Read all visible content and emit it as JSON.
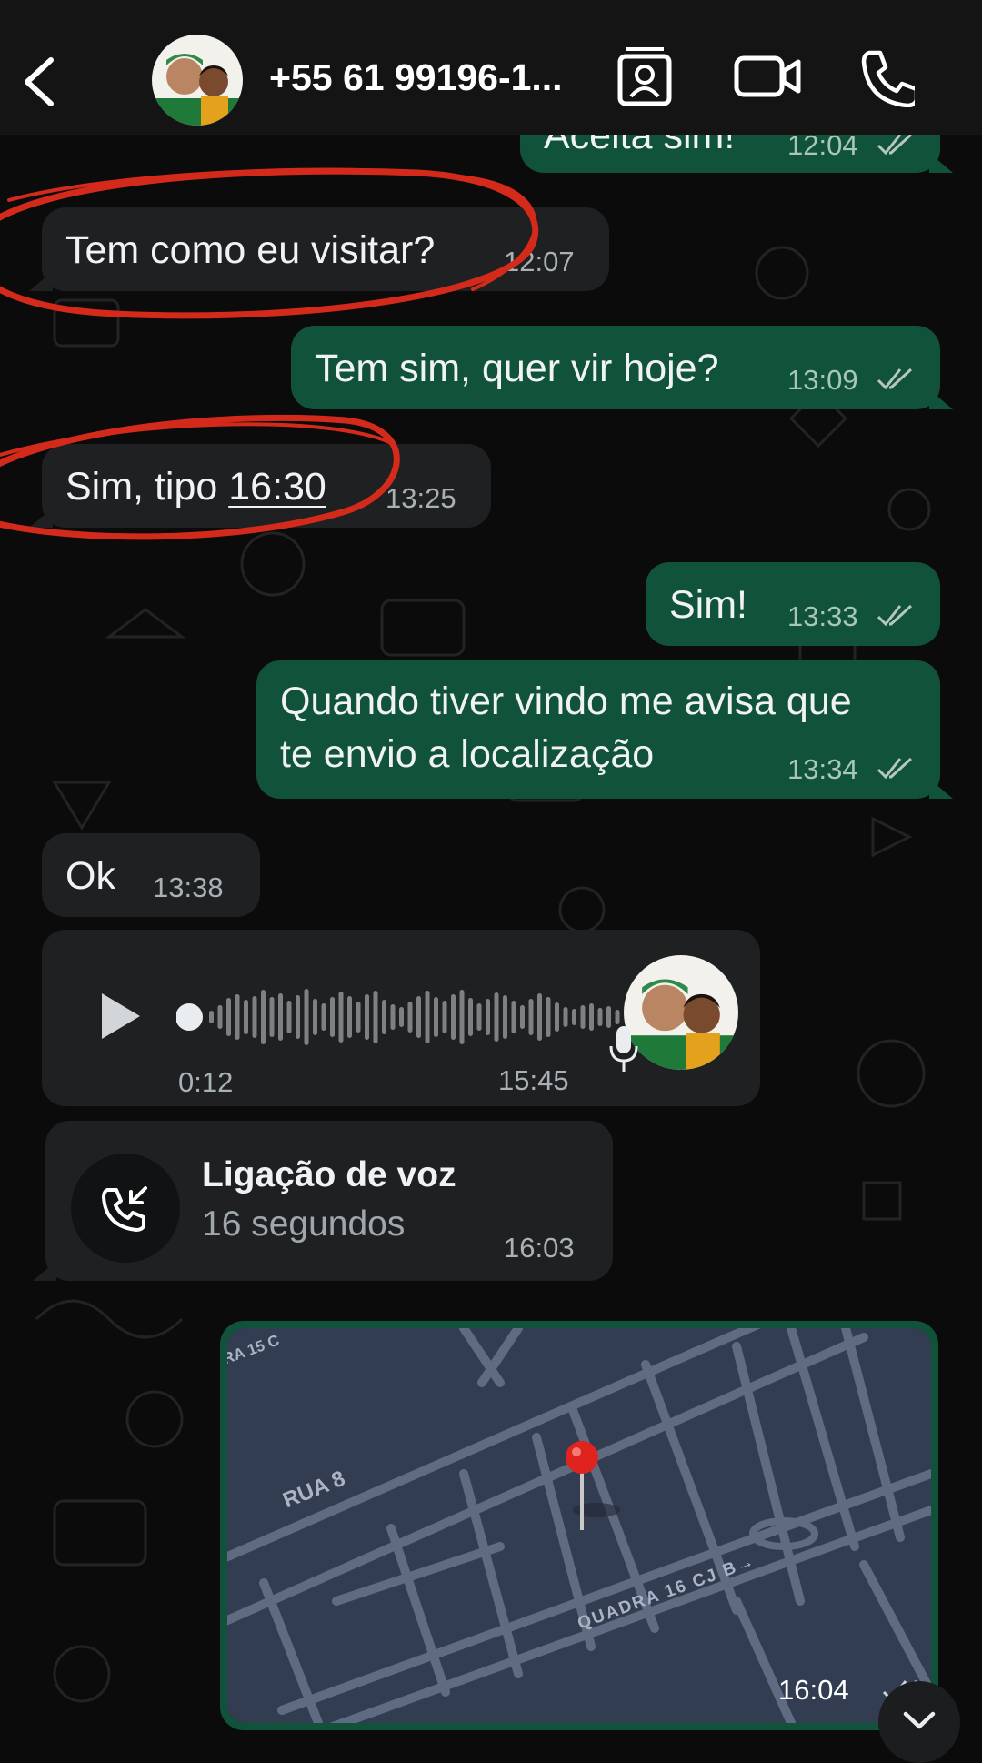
{
  "header": {
    "contact_name": "+55 61 99196-1...",
    "icons": [
      "back-chevron-icon",
      "contact-card-icon",
      "video-call-icon",
      "phone-icon"
    ]
  },
  "messages": [
    {
      "dir": "out",
      "text": "Aceita sim!",
      "time": "12:04",
      "status": "read"
    },
    {
      "dir": "in",
      "text": "Tem como eu visitar?",
      "time": "12:07"
    },
    {
      "dir": "out",
      "text": "Tem sim, quer vir hoje?",
      "time": "13:09",
      "status": "read"
    },
    {
      "dir": "in",
      "text_prefix": "Sim, tipo ",
      "text_link": "16:30",
      "time": "13:25"
    },
    {
      "dir": "out",
      "text": "Sim!",
      "time": "13:33",
      "status": "read"
    },
    {
      "dir": "out",
      "line1": "Quando tiver vindo me avisa que",
      "line2": "te envio a localização",
      "time": "13:34",
      "status": "read"
    },
    {
      "dir": "in",
      "text": "Ok",
      "time": "13:38"
    }
  ],
  "voice_message": {
    "duration": "0:12",
    "time": "15:45",
    "progress": 0
  },
  "call": {
    "title": "Ligação de voz",
    "subtitle": "16 segundos",
    "time": "16:03"
  },
  "location": {
    "time": "16:04",
    "labels": {
      "street1": "RUA 8",
      "street2": "QUADRA 16 CJ B→",
      "street3": "RA 15 C"
    }
  },
  "colors": {
    "background": "#0b0b0b",
    "incoming_bubble": "#1f2021",
    "outgoing_bubble": "#10523a",
    "annotation": "#d42a1b",
    "map_pin": "#e0231f"
  }
}
